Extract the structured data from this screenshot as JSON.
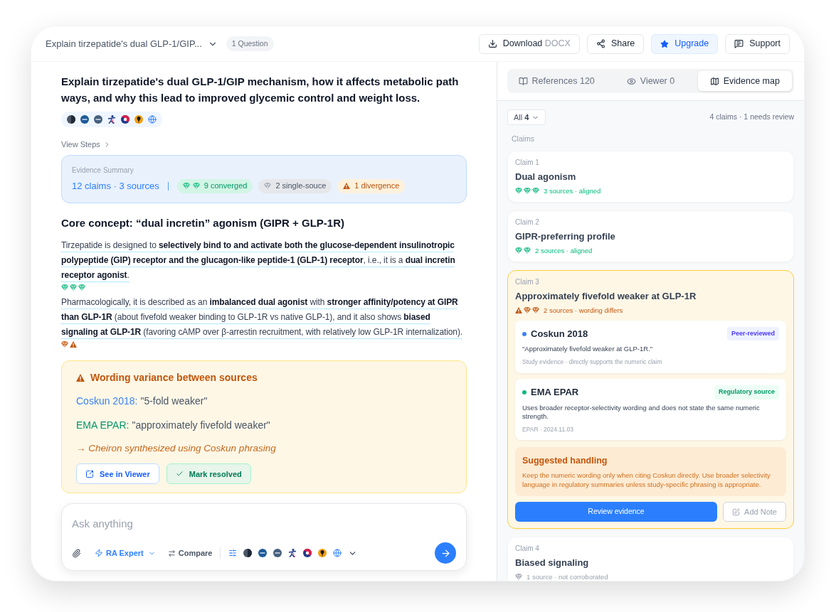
{
  "header": {
    "title": "Explain tirzepatide's dual GLP-1/GIP...",
    "badge": "1 Question",
    "buttons": [
      {
        "kind": "download",
        "label": "Download",
        "suffix": "DOCX"
      },
      {
        "kind": "share",
        "label": "Share"
      },
      {
        "kind": "upgrade",
        "label": "Upgrade"
      },
      {
        "kind": "support",
        "label": "Support"
      }
    ]
  },
  "question": {
    "title": "Explain tirzepatide's dual GLP-1/GIP mechanism, how it affects metabolic pathways, and why this lead to improved glycemic control and weight loss.",
    "view_steps": "View Steps"
  },
  "evidence_summary": {
    "label": "Evidence Summary",
    "counts": "12 claims · 3 sources",
    "pills": [
      {
        "kind": "converged",
        "label": "9 converged"
      },
      {
        "kind": "single",
        "label": "2 single-souce"
      },
      {
        "kind": "divergence",
        "label": "1 divergence"
      }
    ]
  },
  "answer": {
    "heading": "Core concept: “dual incretin” agonism (GIPR + GLP-1R)",
    "paragraphs": [
      {
        "text": "Tirzepatide is designed to **selectively bind to and activate both the glucose-dependent insulinotropic polypeptide (GIP) receptor and the glucagon-like peptide-1 (GLP-1) receptor**, i.e., it is a **dual incretin receptor agonist**.",
        "marks": [
          {
            "kind": "aligned"
          },
          {
            "kind": "aligned"
          },
          {
            "kind": "aligned"
          }
        ]
      },
      {
        "text": "Pharmacologically, it is described as an **imbalanced dual agonist** with **stronger affinity/potency at GIPR than GLP-1R** (about fivefold weaker binding to GLP-1R vs native GLP-1), and it also shows **biased signaling at GLP-1R** (favoring cAMP over β-arrestin recruitment, with relatively low GLP-1R internalization).",
        "marks": [
          {
            "kind": "differs"
          },
          {
            "kind": "warning"
          }
        ]
      }
    ]
  },
  "variance": {
    "title": "Wording variance between sources",
    "sources": [
      {
        "name": "Coskun 2018:",
        "quote": "\"5-fold weaker\"",
        "color": "#3b82f6"
      },
      {
        "name": "EMA EPAR:",
        "quote": "\"approximately fivefold weaker\"",
        "color": "#059669"
      }
    ],
    "conclusion": "→ Cheiron synthesized using Coskun phrasing",
    "buttons": [
      {
        "kind": "viewer",
        "label": "See in Viewer"
      },
      {
        "kind": "resolve",
        "label": "Mark resolved"
      }
    ]
  },
  "composer": {
    "placeholder": "Ask anything",
    "mode": "RA Expert",
    "compare": "Compare"
  },
  "panel": {
    "tabs": [
      {
        "kind": "references",
        "label": "References 120",
        "selected": false
      },
      {
        "kind": "viewer",
        "label": "Viewer 0",
        "selected": false
      },
      {
        "kind": "map",
        "label": "Evidence map",
        "selected": true
      }
    ],
    "filter": {
      "label": "All",
      "count": "4"
    },
    "summary": "4 claims · 1 needs review",
    "section": "Claims",
    "claims": [
      {
        "number": "Claim 1",
        "title": "Dual agonism",
        "kind": "aligned",
        "status": "3 sources · aligned",
        "marks": [
          {
            "kind": "aligned"
          },
          {
            "kind": "aligned"
          },
          {
            "kind": "aligned"
          }
        ],
        "expanded": false
      },
      {
        "number": "Claim 2",
        "title": "GIPR-preferring profile",
        "kind": "aligned",
        "status": "2 sources · aligned",
        "marks": [
          {
            "kind": "aligned"
          },
          {
            "kind": "aligned"
          }
        ],
        "expanded": false
      },
      {
        "number": "Claim 3",
        "title": "Approximately fivefold weaker at GLP-1R",
        "kind": "differs",
        "status": "2 sources · wording differs",
        "marks": [
          {
            "kind": "warning"
          },
          {
            "kind": "differs"
          },
          {
            "kind": "differs"
          }
        ],
        "expanded": true,
        "evidence": [
          {
            "kind": "study",
            "name": "Coskun 2018",
            "color": "#3b82f6",
            "badge": "Peer-reviewed",
            "text": "\"Approximately fivefold weaker at GLP-1R.\"",
            "meta": "Study evidence · directly supports the numeric claim"
          },
          {
            "kind": "regulatory",
            "name": "EMA EPAR",
            "color": "#10b981",
            "badge": "Regulatory source",
            "text": "Uses broader receptor-selectivity wording and does not state the same numeric strength.",
            "meta": "EPAR · 2024.11.03"
          }
        ],
        "handling": {
          "title": "Suggested handling",
          "text": "Keep the numeric wording only when citing Coskun directly. Use broader selectivity language in regulatory summaries unless study-specific phrasing is appropriate."
        },
        "actions": [
          {
            "kind": "primary",
            "label": "Review evidence"
          },
          {
            "kind": "note",
            "label": "Add Note"
          }
        ]
      },
      {
        "number": "Claim 4",
        "title": "Biased signaling",
        "kind": "single",
        "status": "1 source · not corroborated",
        "marks": [
          {
            "kind": "single"
          }
        ],
        "expanded": false
      }
    ]
  }
}
